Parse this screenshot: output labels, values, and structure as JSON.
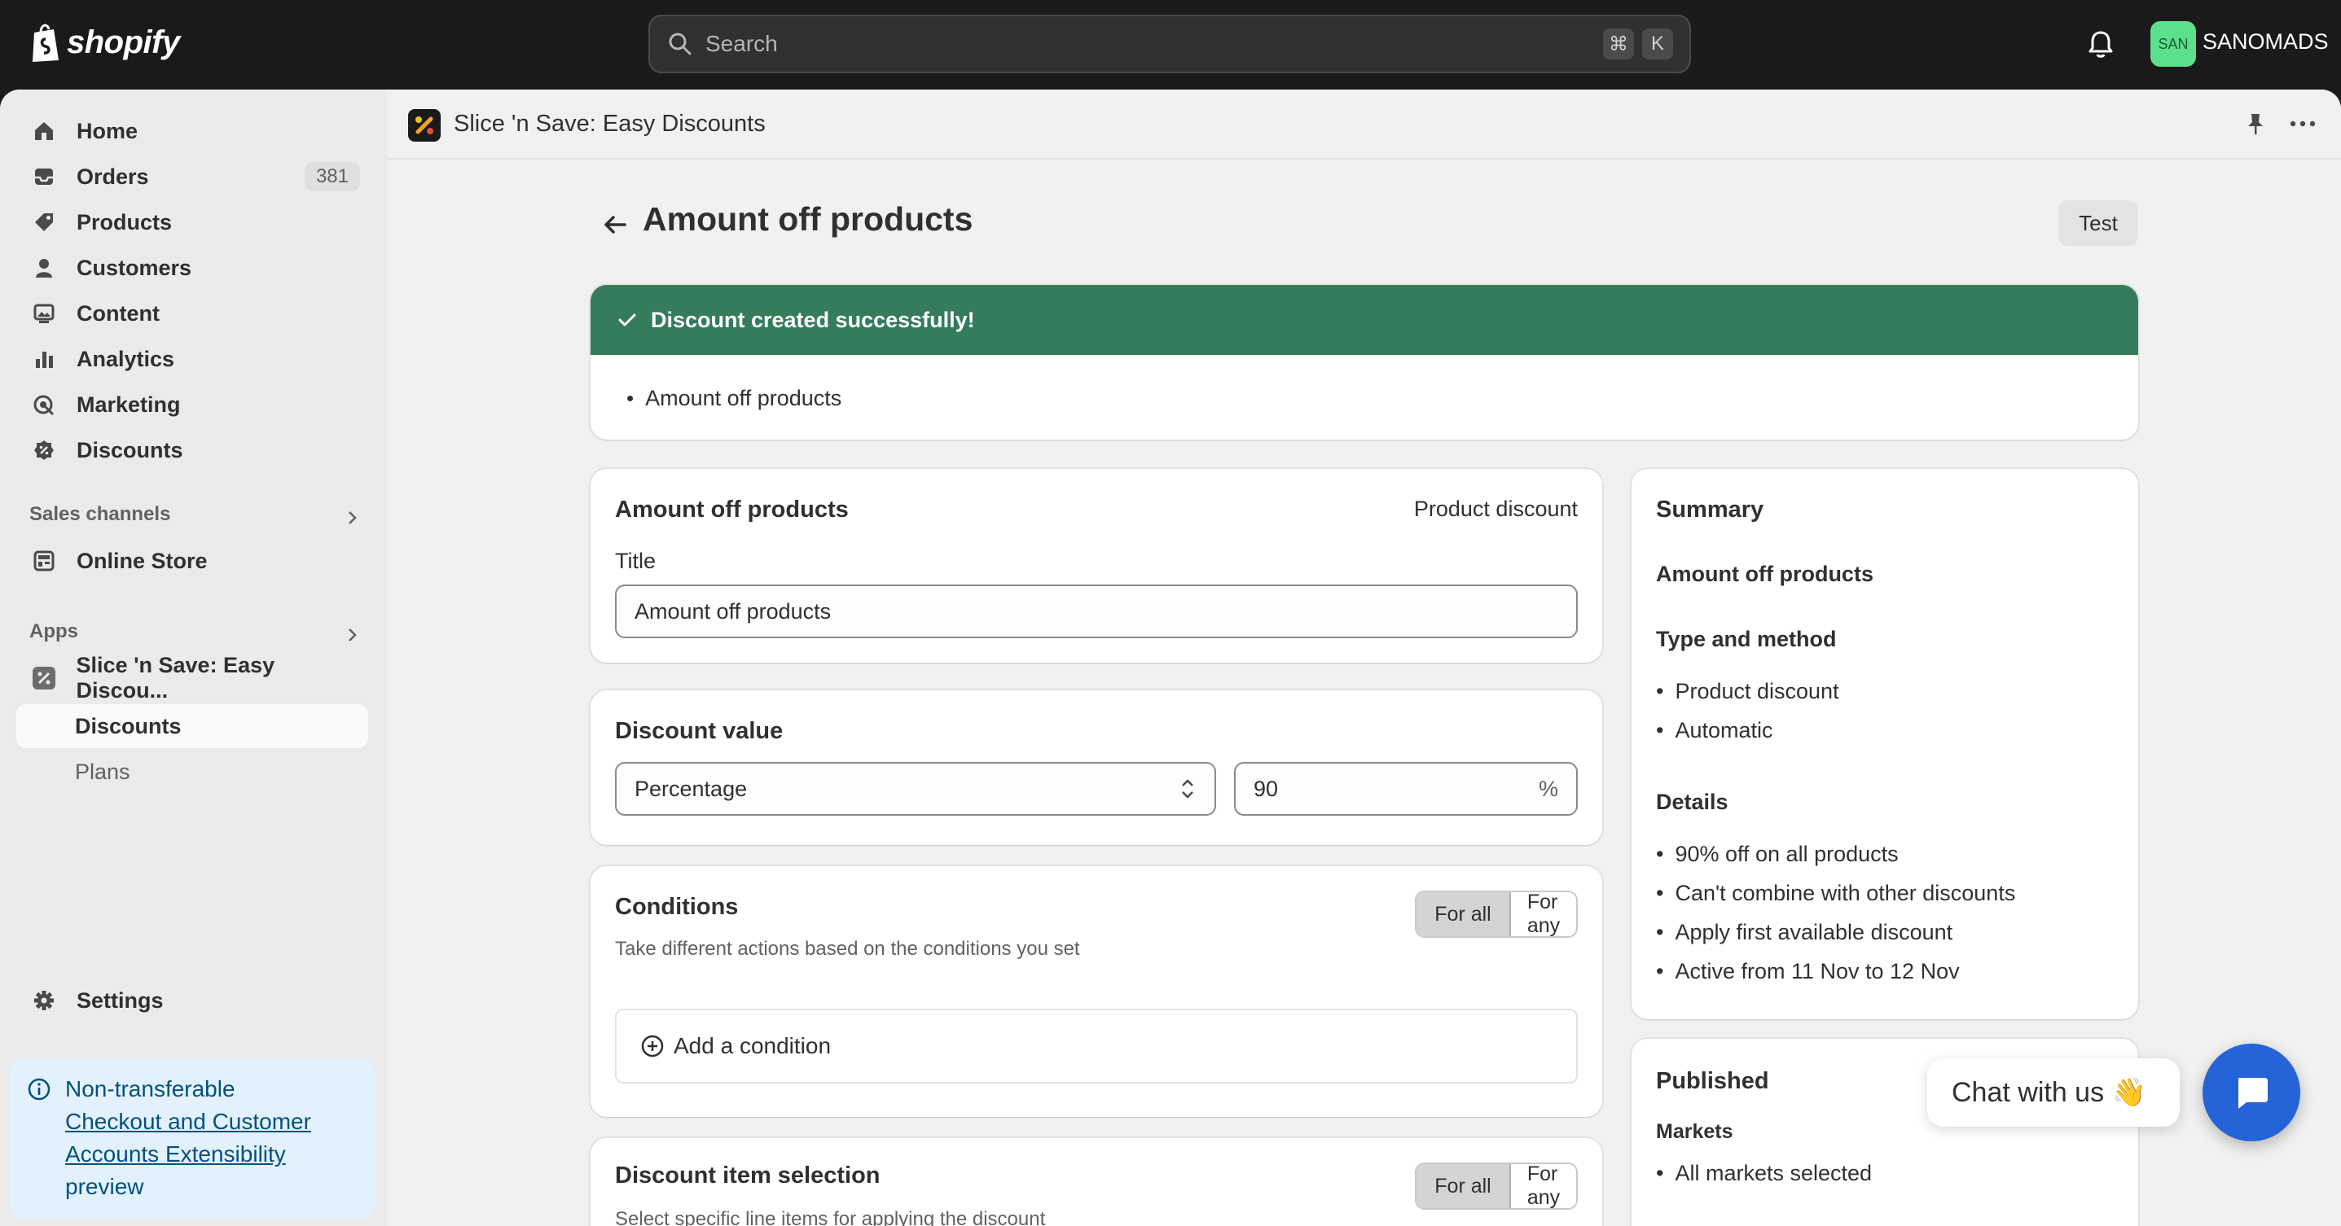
{
  "topbar": {
    "logo_text": "shopify",
    "search_placeholder": "Search",
    "shortcut_cmd": "⌘",
    "shortcut_key": "K",
    "avatar_initials": "SAN",
    "store_name": "SANOMADS"
  },
  "sidebar": {
    "items": [
      {
        "label": "Home",
        "icon": "home-icon"
      },
      {
        "label": "Orders",
        "icon": "inbox-icon",
        "count": "381"
      },
      {
        "label": "Products",
        "icon": "tag-icon"
      },
      {
        "label": "Customers",
        "icon": "person-icon"
      },
      {
        "label": "Content",
        "icon": "image-icon"
      },
      {
        "label": "Analytics",
        "icon": "bar-chart-icon"
      },
      {
        "label": "Marketing",
        "icon": "target-icon"
      },
      {
        "label": "Discounts",
        "icon": "discount-icon"
      }
    ],
    "sales_channels_label": "Sales channels",
    "online_store_label": "Online Store",
    "apps_label": "Apps",
    "app_name": "Slice 'n Save: Easy Discou...",
    "app_sub_discounts": "Discounts",
    "app_sub_plans": "Plans",
    "settings_label": "Settings",
    "banner": {
      "line1": "Non-transferable",
      "link": "Checkout and Customer Accounts Extensibility",
      "line3": "preview"
    }
  },
  "app_header": {
    "title": "Slice 'n Save: Easy Discounts"
  },
  "page": {
    "title": "Amount off products",
    "test_button": "Test"
  },
  "success": {
    "heading": "Discount created successfully!",
    "items": [
      "Amount off products"
    ]
  },
  "method_card": {
    "title": "Amount off products",
    "type": "Product discount",
    "title_label": "Title",
    "title_value": "Amount off products"
  },
  "value_card": {
    "title": "Discount value",
    "type_value": "Percentage",
    "amount_value": "90",
    "suffix": "%"
  },
  "conditions_card": {
    "title": "Conditions",
    "help": "Take different actions based on the conditions you set",
    "seg_all": "For all",
    "seg_any": "For any",
    "add_label": "Add a condition"
  },
  "item_selection_card": {
    "title": "Discount item selection",
    "help": "Select specific line items for applying the discount",
    "seg_all": "For all",
    "seg_any": "For any"
  },
  "summary": {
    "title": "Summary",
    "name": "Amount off products",
    "type_heading": "Type and method",
    "type_items": [
      "Product discount",
      "Automatic"
    ],
    "details_heading": "Details",
    "details_items": [
      "90% off on all products",
      "Can't combine with other discounts",
      "Apply first available discount",
      "Active from 11 Nov to 12 Nov"
    ]
  },
  "published": {
    "title": "Published",
    "markets_heading": "Markets",
    "markets_items": [
      "All markets selected"
    ]
  },
  "chat": {
    "label": "Chat with us 👋"
  },
  "colors": {
    "success_green": "#357c5a",
    "chat_blue": "#2563d9",
    "avatar_green": "#5ce08c"
  }
}
